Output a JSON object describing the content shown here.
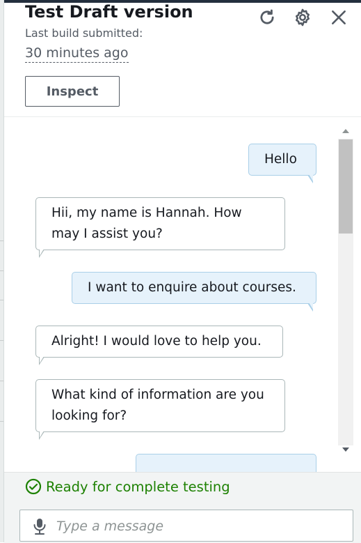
{
  "panel": {
    "title": "Test Draft version",
    "subtitle": "Last build submitted:",
    "build_time": "30 minutes ago",
    "inspect_label": "Inspect"
  },
  "icons": {
    "refresh": "refresh-icon",
    "settings": "settings-icon",
    "close": "close-icon",
    "mic": "microphone-icon",
    "ready": "check-circle-icon"
  },
  "messages": [
    {
      "from": "user",
      "text": "Hello"
    },
    {
      "from": "bot",
      "text": "Hii, my name is Hannah. How may I assist you?"
    },
    {
      "from": "user",
      "text": "I want to enquire about courses."
    },
    {
      "from": "bot",
      "text": "Alright! I would love to help you."
    },
    {
      "from": "bot",
      "text": "What kind of information are you looking for?"
    }
  ],
  "status": {
    "text": "Ready for complete testing",
    "color": "#1d8102"
  },
  "composer": {
    "placeholder": "Type a message"
  },
  "colors": {
    "user_bubble": "#e6f2fb",
    "user_bubble_border": "#a9cfe8",
    "bot_bubble_border": "#aab7b8"
  }
}
